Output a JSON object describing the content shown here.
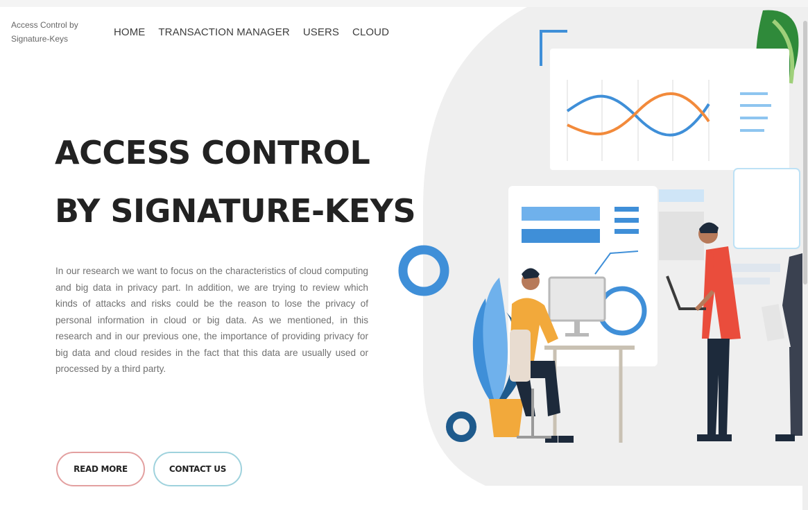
{
  "brand": {
    "line1": "Access Control by",
    "line2": "Signature-Keys"
  },
  "nav": [
    "HOME",
    "TRANSACTION MANAGER",
    "USERS",
    "CLOUD"
  ],
  "hero": {
    "title_line1": "ACCESS CONTROL",
    "title_line2": "BY SIGNATURE-KEYS",
    "description": "In our research we want to focus on the characteristics of cloud computing and big data in privacy part. In addition, we are trying to review which kinds of attacks and risks could be the reason to lose the privacy of personal information in cloud or big data. As we mentioned, in this research and in our previous one, the importance of providing privacy for big data and cloud resides in the fact that this data are usually used or processed by a third party."
  },
  "buttons": {
    "read_more": "READ MORE",
    "contact_us": "CONTACT US"
  },
  "colors": {
    "accent_red": "#e3a0a0",
    "accent_teal": "#9fd2dd",
    "illustration_blue": "#3f8fd8",
    "illustration_orange": "#f2a93b"
  }
}
